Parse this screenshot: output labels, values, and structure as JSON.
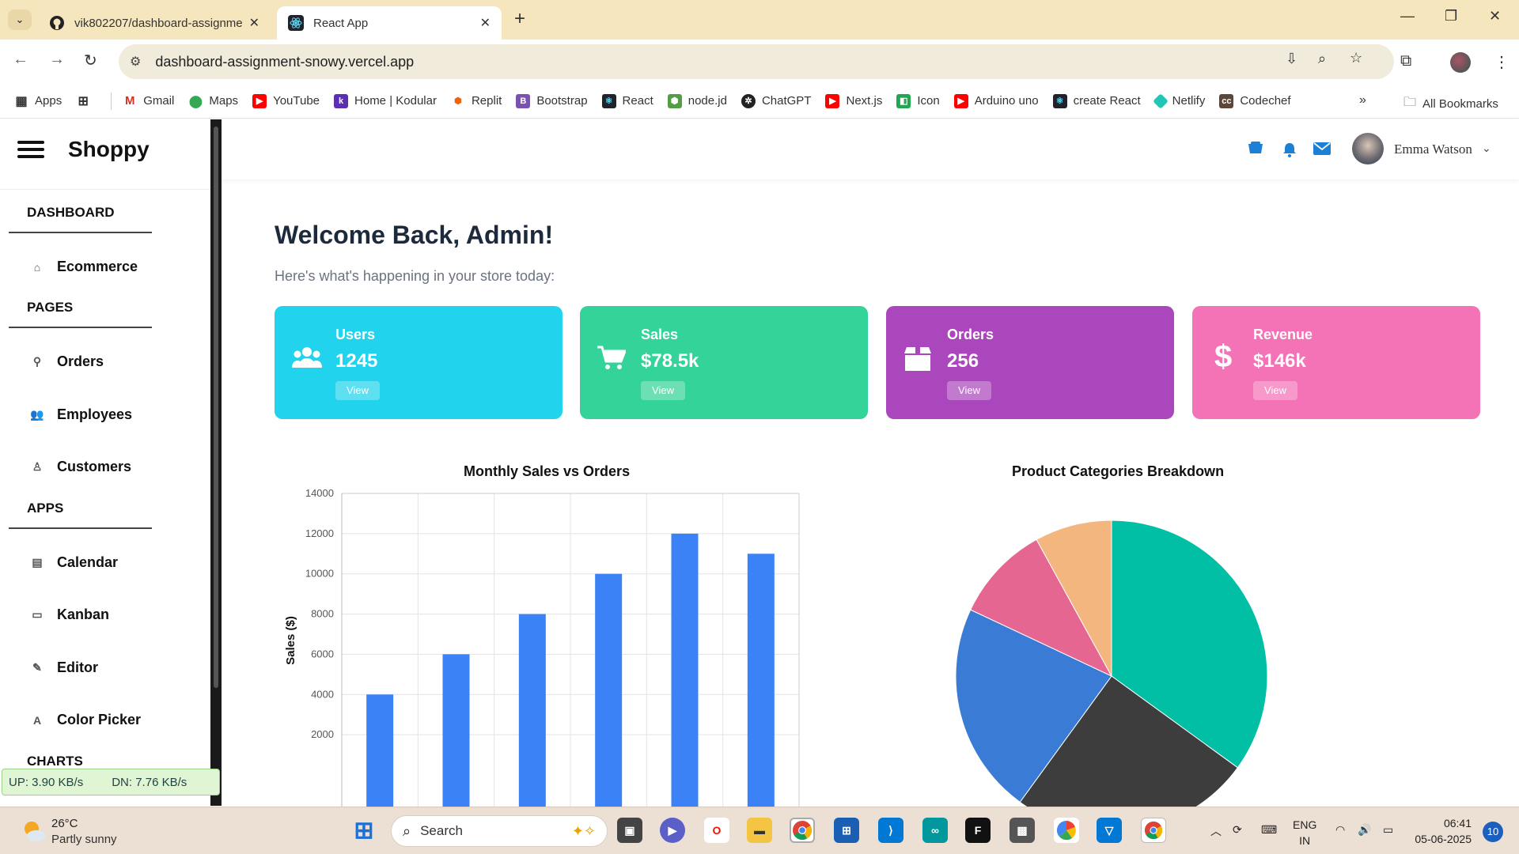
{
  "browser": {
    "tabs": [
      {
        "label": "vik802207/dashboard-assignme",
        "icon": "github-icon"
      },
      {
        "label": "React App",
        "icon": "react-icon"
      }
    ],
    "url": "dashboard-assignment-snowy.vercel.app",
    "bookmarks": [
      "Apps",
      "Gmail",
      "Maps",
      "YouTube",
      "Home | Kodular",
      "Replit",
      "Bootstrap",
      "React",
      "node.jd",
      "ChatGPT",
      "Next.js",
      "Icon",
      "Arduino uno",
      "create React",
      "Netlify",
      "Codechef"
    ],
    "all_bookmarks": "All Bookmarks"
  },
  "sidebar": {
    "brand": "Shoppy",
    "sections": [
      {
        "title": "DASHBOARD",
        "items": [
          {
            "label": "Ecommerce",
            "icon": "home-icon"
          }
        ]
      },
      {
        "title": "PAGES",
        "items": [
          {
            "label": "Orders",
            "icon": "pin-icon"
          },
          {
            "label": "Employees",
            "icon": "people-icon"
          },
          {
            "label": "Customers",
            "icon": "person-icon"
          }
        ]
      },
      {
        "title": "APPS",
        "items": [
          {
            "label": "Calendar",
            "icon": "calendar-icon"
          },
          {
            "label": "Kanban",
            "icon": "folder-icon"
          },
          {
            "label": "Editor",
            "icon": "pencil-icon"
          },
          {
            "label": "Color Picker",
            "icon": "font-icon"
          }
        ]
      },
      {
        "title": "CHARTS",
        "items": []
      }
    ]
  },
  "netspeed": {
    "up": "UP: 3.90 KB/s",
    "down": "DN: 7.76 KB/s"
  },
  "header": {
    "user": "Emma Watson"
  },
  "main": {
    "welcome": "Welcome Back, Admin!",
    "subtitle": "Here's what's happening in your store today:",
    "cards": [
      {
        "label": "Users",
        "value": "1245",
        "button": "View",
        "color": "#22d3ee",
        "icon": "users-icon"
      },
      {
        "label": "Sales",
        "value": "$78.5k",
        "button": "View",
        "color": "#34d399",
        "icon": "cart-icon"
      },
      {
        "label": "Orders",
        "value": "256",
        "button": "View",
        "color": "#ab47bc",
        "icon": "box-icon"
      },
      {
        "label": "Revenue",
        "value": "$146k",
        "button": "View",
        "color": "#f472b6",
        "icon": "dollar-icon"
      }
    ]
  },
  "chart_data": [
    {
      "type": "bar",
      "title": "Monthly Sales vs Orders",
      "ylabel": "Sales ($)",
      "xlabel": "",
      "categories": [
        "",
        "",
        "",
        "",
        "",
        ""
      ],
      "series": [
        {
          "values": [
            4000,
            6000,
            8000,
            10000,
            12000,
            11000
          ],
          "color": "#3b82f6"
        }
      ],
      "yticks": [
        2000,
        4000,
        6000,
        8000,
        10000,
        12000,
        14000
      ],
      "ylim": [
        0,
        14000
      ],
      "grid": true
    },
    {
      "type": "pie",
      "title": "Product Categories Breakdown",
      "values": [
        35,
        25,
        22,
        10,
        8
      ],
      "colors": [
        "#00bfa5",
        "#3d3d3d",
        "#3a7bd5",
        "#e56691",
        "#f4b67f"
      ]
    }
  ],
  "taskbar": {
    "weather": {
      "temp": "26°C",
      "desc": "Partly sunny"
    },
    "search": "Search",
    "lang": [
      "ENG",
      "IN"
    ],
    "time": "06:41",
    "date": "05-06-2025",
    "notifications": "10"
  }
}
